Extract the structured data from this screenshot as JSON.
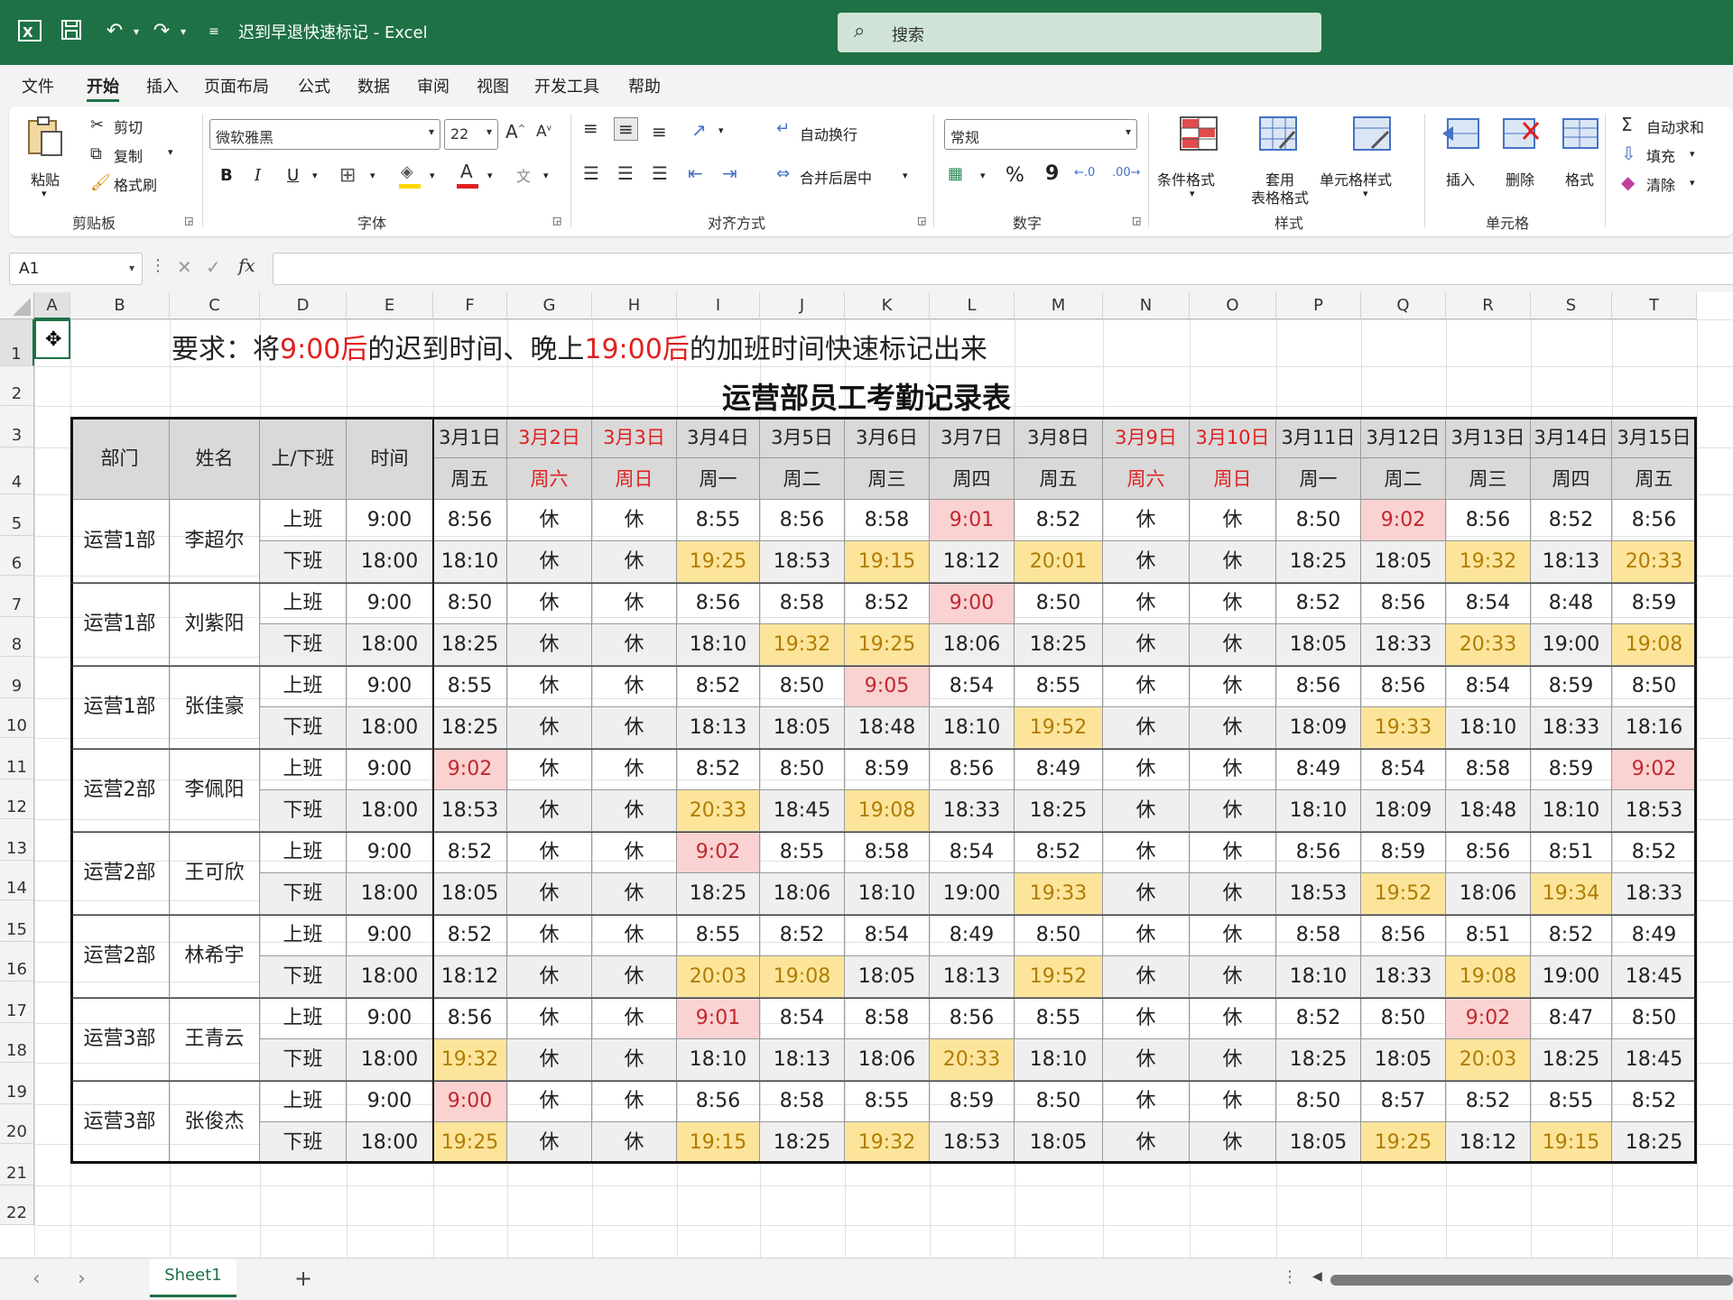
{
  "titlebar": {
    "doc_title": "迟到早退快速标记 - Excel",
    "search_placeholder": "搜索"
  },
  "menu": [
    "文件",
    "开始",
    "插入",
    "页面布局",
    "公式",
    "数据",
    "审阅",
    "视图",
    "开发工具",
    "帮助"
  ],
  "ribbon": {
    "clipboard": {
      "paste": "粘贴",
      "cut": "剪切",
      "copy": "复制",
      "format_painter": "格式刷",
      "group": "剪贴板"
    },
    "font": {
      "name": "微软雅黑",
      "size": "22",
      "bold": "B",
      "italic": "I",
      "underline": "U",
      "group": "字体"
    },
    "alignment": {
      "wrap": "自动换行",
      "merge": "合并后居中",
      "group": "对齐方式"
    },
    "number": {
      "format": "常规",
      "percent": "%",
      "comma": "9",
      "group": "数字"
    },
    "styles": {
      "conditional": "条件格式",
      "table_l1": "套用",
      "table_l2": "表格格式",
      "cell_styles": "单元格样式",
      "group": "样式"
    },
    "cells": {
      "insert": "插入",
      "delete": "删除",
      "format": "格式",
      "group": "单元格"
    },
    "editing": {
      "autosum": "自动求和",
      "fill": "填充",
      "clear": "清除"
    }
  },
  "formula_bar": {
    "name_box": "A1",
    "fx": "fx",
    "content": ""
  },
  "columns": [
    "A",
    "B",
    "C",
    "D",
    "E",
    "F",
    "G",
    "H",
    "I",
    "J",
    "K",
    "L",
    "M",
    "N",
    "O",
    "P",
    "Q",
    "R",
    "S",
    "T"
  ],
  "rows": [
    "1",
    "2",
    "3",
    "4",
    "5",
    "6",
    "7",
    "8",
    "9",
    "10",
    "11",
    "12",
    "13",
    "14",
    "15",
    "16",
    "17",
    "18",
    "19",
    "20",
    "21",
    "22"
  ],
  "note": {
    "p1": "要求：将",
    "r1": "9:00后",
    "p2": "的迟到时间、晚上",
    "r2": "19:00后",
    "p3": "的加班时间快速标记出来"
  },
  "table_title": "运营部员工考勤记录表",
  "headers": {
    "dept": "部门",
    "name": "姓名",
    "shift": "上/下班",
    "time": "时间"
  },
  "dates": [
    "3月1日",
    "3月2日",
    "3月3日",
    "3月4日",
    "3月5日",
    "3月6日",
    "3月7日",
    "3月8日",
    "3月9日",
    "3月10日",
    "3月11日",
    "3月12日",
    "3月13日",
    "3月14日",
    "3月15日"
  ],
  "weekdays": [
    "周五",
    "周六",
    "周日",
    "周一",
    "周二",
    "周三",
    "周四",
    "周五",
    "周六",
    "周日",
    "周一",
    "周二",
    "周三",
    "周四",
    "周五"
  ],
  "weekend_columns": [
    1,
    2,
    8,
    9
  ],
  "shift_labels": {
    "on": "上班",
    "off": "下班"
  },
  "std_times": {
    "on": "9:00",
    "off": "18:00"
  },
  "employees": [
    {
      "dept": "运营1部",
      "name": "李超尔",
      "on": [
        "8:56",
        "休",
        "休",
        "8:55",
        "8:56",
        "8:58",
        "9:01",
        "8:52",
        "休",
        "休",
        "8:50",
        "9:02",
        "8:56",
        "8:52",
        "8:56"
      ],
      "off": [
        "18:10",
        "休",
        "休",
        "19:25",
        "18:53",
        "19:15",
        "18:12",
        "20:01",
        "休",
        "休",
        "18:25",
        "18:05",
        "19:32",
        "18:13",
        "20:33"
      ]
    },
    {
      "dept": "运营1部",
      "name": "刘紫阳",
      "on": [
        "8:50",
        "休",
        "休",
        "8:56",
        "8:58",
        "8:52",
        "9:00",
        "8:50",
        "休",
        "休",
        "8:52",
        "8:56",
        "8:54",
        "8:48",
        "8:59"
      ],
      "off": [
        "18:25",
        "休",
        "休",
        "18:10",
        "19:32",
        "19:25",
        "18:06",
        "18:25",
        "休",
        "休",
        "18:05",
        "18:33",
        "20:33",
        "19:00",
        "19:08"
      ]
    },
    {
      "dept": "运营1部",
      "name": "张佳豪",
      "on": [
        "8:55",
        "休",
        "休",
        "8:52",
        "8:50",
        "9:05",
        "8:54",
        "8:55",
        "休",
        "休",
        "8:56",
        "8:56",
        "8:54",
        "8:59",
        "8:50"
      ],
      "off": [
        "18:25",
        "休",
        "休",
        "18:13",
        "18:05",
        "18:48",
        "18:10",
        "19:52",
        "休",
        "休",
        "18:09",
        "19:33",
        "18:10",
        "18:33",
        "18:16"
      ]
    },
    {
      "dept": "运营2部",
      "name": "李佩阳",
      "on": [
        "9:02",
        "休",
        "休",
        "8:52",
        "8:50",
        "8:59",
        "8:56",
        "8:49",
        "休",
        "休",
        "8:49",
        "8:54",
        "8:58",
        "8:59",
        "9:02"
      ],
      "off": [
        "18:53",
        "休",
        "休",
        "20:33",
        "18:45",
        "19:08",
        "18:33",
        "18:25",
        "休",
        "休",
        "18:10",
        "18:09",
        "18:48",
        "18:10",
        "18:53"
      ]
    },
    {
      "dept": "运营2部",
      "name": "王可欣",
      "on": [
        "8:52",
        "休",
        "休",
        "9:02",
        "8:55",
        "8:58",
        "8:54",
        "8:52",
        "休",
        "休",
        "8:56",
        "8:59",
        "8:56",
        "8:51",
        "8:52"
      ],
      "off": [
        "18:05",
        "休",
        "休",
        "18:25",
        "18:06",
        "18:10",
        "19:00",
        "19:33",
        "休",
        "休",
        "18:53",
        "19:52",
        "18:06",
        "19:34",
        "18:33"
      ]
    },
    {
      "dept": "运营2部",
      "name": "林希宇",
      "on": [
        "8:52",
        "休",
        "休",
        "8:55",
        "8:52",
        "8:54",
        "8:49",
        "8:50",
        "休",
        "休",
        "8:58",
        "8:56",
        "8:51",
        "8:52",
        "8:49"
      ],
      "off": [
        "18:12",
        "休",
        "休",
        "20:03",
        "19:08",
        "18:05",
        "18:13",
        "19:52",
        "休",
        "休",
        "18:10",
        "18:33",
        "19:08",
        "19:00",
        "18:45"
      ]
    },
    {
      "dept": "运营3部",
      "name": "王青云",
      "on": [
        "8:56",
        "休",
        "休",
        "9:01",
        "8:54",
        "8:58",
        "8:56",
        "8:55",
        "休",
        "休",
        "8:52",
        "8:50",
        "9:02",
        "8:47",
        "8:50"
      ],
      "off": [
        "19:32",
        "休",
        "休",
        "18:10",
        "18:13",
        "18:06",
        "20:33",
        "18:10",
        "休",
        "休",
        "18:25",
        "18:05",
        "20:03",
        "18:25",
        "18:45"
      ]
    },
    {
      "dept": "运营3部",
      "name": "张俊杰",
      "on": [
        "9:00",
        "休",
        "休",
        "8:56",
        "8:58",
        "8:55",
        "8:59",
        "8:50",
        "休",
        "休",
        "8:50",
        "8:57",
        "8:52",
        "8:55",
        "8:52"
      ],
      "off": [
        "19:25",
        "休",
        "休",
        "19:15",
        "18:25",
        "19:32",
        "18:53",
        "18:05",
        "休",
        "休",
        "18:05",
        "19:25",
        "18:12",
        "19:15",
        "18:25"
      ]
    }
  ],
  "highlights": {
    "late": [
      [
        0,
        6
      ],
      [
        0,
        11
      ],
      [
        1,
        6
      ],
      [
        2,
        5
      ],
      [
        3,
        0
      ],
      [
        3,
        14
      ],
      [
        4,
        3
      ],
      [
        6,
        3
      ],
      [
        6,
        12
      ],
      [
        7,
        0
      ]
    ],
    "overtime": [
      [
        0,
        3
      ],
      [
        0,
        5
      ],
      [
        0,
        7
      ],
      [
        0,
        12
      ],
      [
        0,
        14
      ],
      [
        1,
        4
      ],
      [
        1,
        5
      ],
      [
        1,
        12
      ],
      [
        1,
        14
      ],
      [
        2,
        7
      ],
      [
        2,
        11
      ],
      [
        3,
        3
      ],
      [
        3,
        5
      ],
      [
        4,
        7
      ],
      [
        4,
        11
      ],
      [
        4,
        13
      ],
      [
        5,
        3
      ],
      [
        5,
        4
      ],
      [
        5,
        7
      ],
      [
        5,
        12
      ],
      [
        6,
        0
      ],
      [
        6,
        6
      ],
      [
        6,
        12
      ],
      [
        7,
        0
      ],
      [
        7,
        3
      ],
      [
        7,
        5
      ],
      [
        7,
        11
      ],
      [
        7,
        13
      ]
    ]
  },
  "colors": {
    "late_fill": "#fad2d2",
    "overtime_fill": "#fce59b",
    "header_fill": "#d9d9d9",
    "weekend_text": "#e02020",
    "excel_green": "#1e7145"
  },
  "statusbar": {
    "sheet_tab": "Sheet1",
    "add": "+"
  }
}
